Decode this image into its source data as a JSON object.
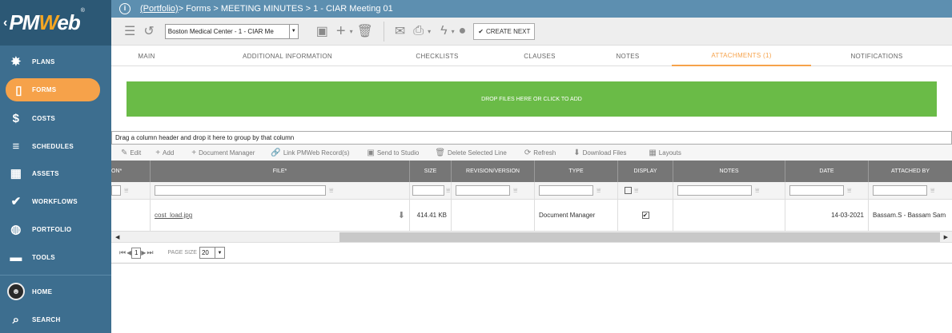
{
  "logo": {
    "brand_left": "PM",
    "brand_w": "W",
    "brand_right": "eb",
    "reg": "®"
  },
  "sidebar": {
    "items": [
      {
        "label": "PLANS",
        "icon": "lightbulb-icon",
        "glyph": "💡"
      },
      {
        "label": "FORMS",
        "icon": "document-icon",
        "glyph": "🗍"
      },
      {
        "label": "COSTS",
        "icon": "dollar-icon",
        "glyph": "$"
      },
      {
        "label": "SCHEDULES",
        "icon": "schedule-bars-icon",
        "glyph": "☰"
      },
      {
        "label": "ASSETS",
        "icon": "building-icon",
        "glyph": "▦"
      },
      {
        "label": "WORKFLOWS",
        "icon": "checkmark-icon",
        "glyph": "✔"
      },
      {
        "label": "PORTFOLIO",
        "icon": "globe-icon",
        "glyph": "🌐"
      },
      {
        "label": "TOOLS",
        "icon": "toolbox-icon",
        "glyph": "🧰"
      },
      {
        "label": "HOME",
        "icon": "avatar-icon",
        "glyph": ""
      },
      {
        "label": "SEARCH",
        "icon": "search-icon",
        "glyph": "🔍"
      }
    ]
  },
  "breadcrumb": {
    "link": "(Portfolio)",
    "rest": " > Forms > MEETING MINUTES > 1 - CIAR Meeting 01"
  },
  "toolbar": {
    "record_select": "Boston Medical Center - 1 - CIAR Me",
    "create_next": "CREATE NEXT"
  },
  "tabs": [
    "MAIN",
    "ADDITIONAL INFORMATION",
    "CHECKLISTS",
    "CLAUSES",
    "NOTES",
    "ATTACHMENTS (1)",
    "NOTIFICATIONS"
  ],
  "dropzone": "DROP FILES HERE OR CLICK TO ADD",
  "grid": {
    "group_hint": "Drag a column header and drop it here to group by that column",
    "tools": [
      "Edit",
      "Add",
      "Document Manager",
      "Link PMWeb Record(s)",
      "Send to Studio",
      "Delete Selected Line",
      "Refresh",
      "Download Files",
      "Layouts"
    ],
    "columns": [
      "ON*",
      "FILE*",
      "SIZE",
      "REVISION/VERSION",
      "TYPE",
      "DISPLAY",
      "NOTES",
      "DATE",
      "ATTACHED BY"
    ],
    "row": {
      "file": "cost_load.jpg",
      "size": "414.41 KB",
      "revision": "",
      "type": "Document Manager",
      "display": "✔",
      "notes": "",
      "date": "14-03-2021",
      "attached_by": "Bassam.S - Bassam Sam"
    },
    "pager": {
      "page": "1",
      "page_size_label": "PAGE SIZE",
      "page_size": "20"
    }
  },
  "colors": {
    "sidebar": "#3d6e8f",
    "accent": "#f6a24a",
    "dropzone": "#6abb47"
  }
}
